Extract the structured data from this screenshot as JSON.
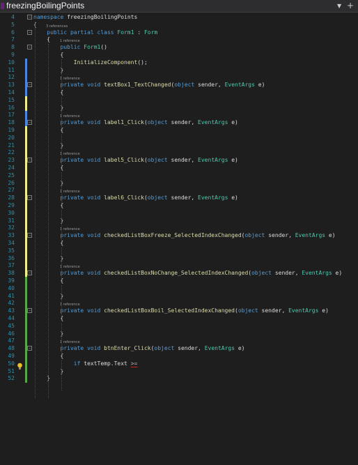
{
  "window": {
    "tab_title": "freezingBoilingPoints"
  },
  "colors": {
    "background": "#1e1e1e",
    "line_number": "#2b91af",
    "keyword": "#569cd6",
    "type": "#4ec9b0",
    "method": "#dcdcaa",
    "plain": "#dcdcdc",
    "reference": "#999999",
    "change_saved": "#57a64a",
    "change_unsaved": "#efef8c",
    "change_modified": "#4a85e0"
  },
  "icons": {
    "title": "solution-icon",
    "dropdown": "chevron-down-icon",
    "add": "plus-icon",
    "bulb": "lightbulb-icon"
  },
  "ref_labels": {
    "three": "3 references",
    "one": "1 reference"
  },
  "lines": [
    {
      "n": "4",
      "t": [
        [
          "kw",
          "namespace"
        ],
        [
          "p",
          " freezingBoilingPoints"
        ]
      ]
    },
    {
      "n": "5",
      "t": [
        [
          "p",
          "{"
        ]
      ]
    },
    {
      "n": "6",
      "t": [
        [
          "p",
          "    "
        ],
        [
          "kw",
          "public partial class"
        ],
        [
          "p",
          " "
        ],
        [
          "ty",
          "Form1"
        ],
        [
          "p",
          " : "
        ],
        [
          "ty",
          "Form"
        ]
      ]
    },
    {
      "n": "7",
      "t": [
        [
          "p",
          "    {"
        ]
      ]
    },
    {
      "n": "8",
      "t": [
        [
          "p",
          "        "
        ],
        [
          "kw",
          "public"
        ],
        [
          "p",
          " "
        ],
        [
          "ty",
          "Form1"
        ],
        [
          "p",
          "()"
        ]
      ]
    },
    {
      "n": "9",
      "t": [
        [
          "p",
          "        {"
        ]
      ]
    },
    {
      "n": "10",
      "t": [
        [
          "p",
          "            "
        ],
        [
          "me",
          "InitializeComponent"
        ],
        [
          "p",
          "();"
        ]
      ]
    },
    {
      "n": "11",
      "t": [
        [
          "p",
          "        }"
        ]
      ]
    },
    {
      "n": "12",
      "t": []
    },
    {
      "n": "13",
      "t": [
        [
          "p",
          "        "
        ],
        [
          "kw",
          "private void"
        ],
        [
          "p",
          " "
        ],
        [
          "me",
          "textBox1_TextChanged"
        ],
        [
          "p",
          "("
        ],
        [
          "kw",
          "object"
        ],
        [
          "p",
          " sender, "
        ],
        [
          "ty",
          "EventArgs"
        ],
        [
          "p",
          " e)"
        ]
      ]
    },
    {
      "n": "14",
      "t": [
        [
          "p",
          "        {"
        ]
      ]
    },
    {
      "n": "15",
      "t": []
    },
    {
      "n": "16",
      "t": [
        [
          "p",
          "        }"
        ]
      ]
    },
    {
      "n": "17",
      "t": []
    },
    {
      "n": "18",
      "t": [
        [
          "p",
          "        "
        ],
        [
          "kw",
          "private void"
        ],
        [
          "p",
          " "
        ],
        [
          "me",
          "label1_Click"
        ],
        [
          "p",
          "("
        ],
        [
          "kw",
          "object"
        ],
        [
          "p",
          " sender, "
        ],
        [
          "ty",
          "EventArgs"
        ],
        [
          "p",
          " e)"
        ]
      ]
    },
    {
      "n": "19",
      "t": [
        [
          "p",
          "        {"
        ]
      ]
    },
    {
      "n": "20",
      "t": []
    },
    {
      "n": "21",
      "t": [
        [
          "p",
          "        }"
        ]
      ]
    },
    {
      "n": "22",
      "t": []
    },
    {
      "n": "23",
      "t": [
        [
          "p",
          "        "
        ],
        [
          "kw",
          "private void"
        ],
        [
          "p",
          " "
        ],
        [
          "me",
          "label5_Click"
        ],
        [
          "p",
          "("
        ],
        [
          "kw",
          "object"
        ],
        [
          "p",
          " sender, "
        ],
        [
          "ty",
          "EventArgs"
        ],
        [
          "p",
          " e)"
        ]
      ]
    },
    {
      "n": "24",
      "t": [
        [
          "p",
          "        {"
        ]
      ]
    },
    {
      "n": "25",
      "t": []
    },
    {
      "n": "26",
      "t": [
        [
          "p",
          "        }"
        ]
      ]
    },
    {
      "n": "27",
      "t": []
    },
    {
      "n": "28",
      "t": [
        [
          "p",
          "        "
        ],
        [
          "kw",
          "private void"
        ],
        [
          "p",
          " "
        ],
        [
          "me",
          "label6_Click"
        ],
        [
          "p",
          "("
        ],
        [
          "kw",
          "object"
        ],
        [
          "p",
          " sender, "
        ],
        [
          "ty",
          "EventArgs"
        ],
        [
          "p",
          " e)"
        ]
      ]
    },
    {
      "n": "29",
      "t": [
        [
          "p",
          "        {"
        ]
      ]
    },
    {
      "n": "30",
      "t": []
    },
    {
      "n": "31",
      "t": [
        [
          "p",
          "        }"
        ]
      ]
    },
    {
      "n": "32",
      "t": []
    },
    {
      "n": "33",
      "t": [
        [
          "p",
          "        "
        ],
        [
          "kw",
          "private void"
        ],
        [
          "p",
          " "
        ],
        [
          "me",
          "checkedListBoxFreeze_SelectedIndexChanged"
        ],
        [
          "p",
          "("
        ],
        [
          "kw",
          "object"
        ],
        [
          "p",
          " sender, "
        ],
        [
          "ty",
          "EventArgs"
        ],
        [
          "p",
          " e)"
        ]
      ]
    },
    {
      "n": "34",
      "t": [
        [
          "p",
          "        {"
        ]
      ]
    },
    {
      "n": "35",
      "t": []
    },
    {
      "n": "36",
      "t": [
        [
          "p",
          "        }"
        ]
      ]
    },
    {
      "n": "37",
      "t": []
    },
    {
      "n": "38",
      "t": [
        [
          "p",
          "        "
        ],
        [
          "kw",
          "private void"
        ],
        [
          "p",
          " "
        ],
        [
          "me",
          "checkedListBoxNoChange_SelectedIndexChanged"
        ],
        [
          "p",
          "("
        ],
        [
          "kw",
          "object"
        ],
        [
          "p",
          " sender, "
        ],
        [
          "ty",
          "EventArgs"
        ],
        [
          "p",
          " e)"
        ]
      ]
    },
    {
      "n": "39",
      "t": [
        [
          "p",
          "        {"
        ]
      ]
    },
    {
      "n": "40",
      "t": []
    },
    {
      "n": "41",
      "t": [
        [
          "p",
          "        }"
        ]
      ]
    },
    {
      "n": "42",
      "t": []
    },
    {
      "n": "43",
      "t": [
        [
          "p",
          "        "
        ],
        [
          "kw",
          "private void"
        ],
        [
          "p",
          " "
        ],
        [
          "me",
          "checkedListBoxBoil_SelectedIndexChanged"
        ],
        [
          "p",
          "("
        ],
        [
          "kw",
          "object"
        ],
        [
          "p",
          " sender, "
        ],
        [
          "ty",
          "EventArgs"
        ],
        [
          "p",
          " e)"
        ]
      ]
    },
    {
      "n": "44",
      "t": [
        [
          "p",
          "        {"
        ]
      ]
    },
    {
      "n": "45",
      "t": []
    },
    {
      "n": "46",
      "t": [
        [
          "p",
          "        }"
        ]
      ]
    },
    {
      "n": "47",
      "t": []
    },
    {
      "n": "48",
      "t": [
        [
          "p",
          "        "
        ],
        [
          "kw",
          "private void"
        ],
        [
          "p",
          " "
        ],
        [
          "me",
          "btnEnter_Click"
        ],
        [
          "p",
          "("
        ],
        [
          "kw",
          "object"
        ],
        [
          "p",
          " sender, "
        ],
        [
          "ty",
          "EventArgs"
        ],
        [
          "p",
          " e)"
        ]
      ]
    },
    {
      "n": "49",
      "t": [
        [
          "p",
          "        {"
        ]
      ]
    },
    {
      "n": "50",
      "t": [
        [
          "p",
          "            "
        ],
        [
          "kw",
          "if"
        ],
        [
          "p",
          " textTemp.Text "
        ],
        [
          "err",
          ">="
        ]
      ]
    },
    {
      "n": "51",
      "t": [
        [
          "p",
          "        }"
        ]
      ]
    },
    {
      "n": "52",
      "t": [
        [
          "p",
          "    }"
        ]
      ]
    }
  ]
}
